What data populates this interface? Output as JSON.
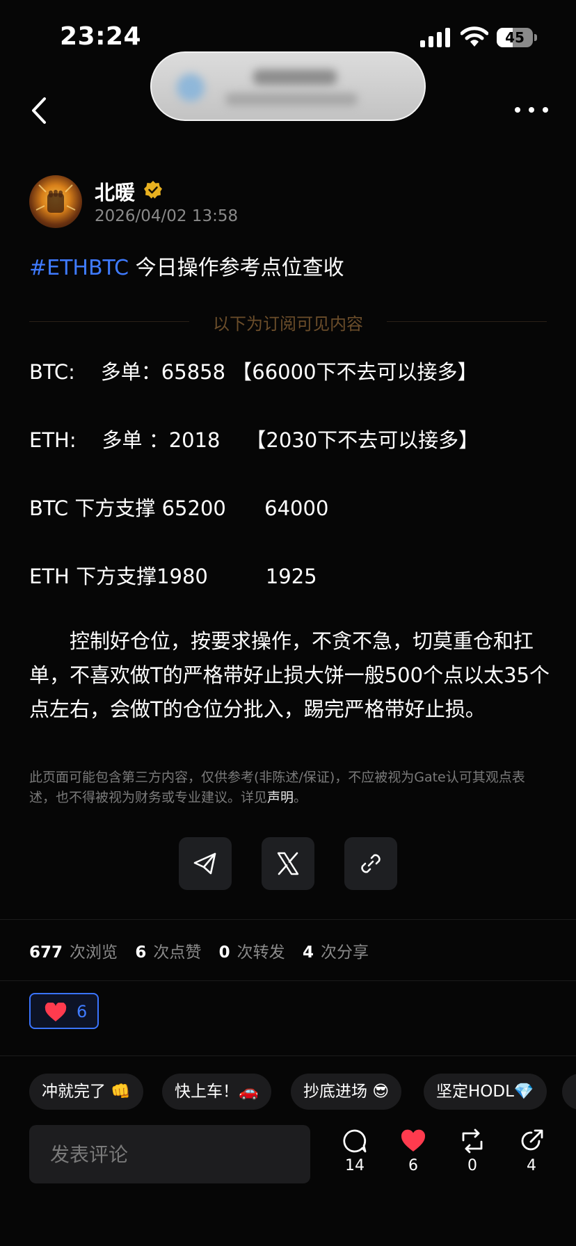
{
  "status_bar": {
    "time": "23:24",
    "battery": "45",
    "battery_level": 0.45
  },
  "post": {
    "author": "北暖",
    "timestamp": "2026/04/02 13:58",
    "hashtag": "#ETHBTC",
    "title": " 今日操作参考点位查收",
    "subscriber_label": "以下为订阅可见内容",
    "lines": [
      "BTC:    多单：65858 【66000下不去可以接多】",
      "ETH:    多单 ：2018    【2030下不去可以接多】",
      "BTC 下方支撑 65200      64000",
      "ETH 下方支撑1980         1925"
    ],
    "paragraph": "　　控制好仓位，按要求操作，不贪不急，切莫重仓和扛单，不喜欢做T的严格带好止损大饼一般500个点以太35个点左右，会做T的仓位分批入，踢完严格带好止损。"
  },
  "disclaimer": {
    "text": "此页面可能包含第三方内容，仅供参考(非陈述/保证)，不应被视为Gate认可其观点表述，也不得被视为财务或专业建议。详见",
    "link": "声明",
    "end": "。"
  },
  "stats": [
    {
      "value": "677",
      "label": "次浏览"
    },
    {
      "value": "6",
      "label": "次点赞"
    },
    {
      "value": "0",
      "label": "次转发"
    },
    {
      "value": "4",
      "label": "次分享"
    }
  ],
  "like_chip": {
    "count": "6"
  },
  "reactions": [
    "冲就完了 👊",
    "快上车！🚗",
    "抄底进场 😎",
    "坚定HODL💎"
  ],
  "comment": {
    "placeholder": "发表评论"
  },
  "actions": {
    "comments": "14",
    "likes": "6",
    "reposts": "0",
    "shares": "4"
  },
  "colors": {
    "accent": "#3f7bff",
    "heart": "#ff3b4e",
    "gold": "#e8b120",
    "subscriber_label": "#6b4d2a"
  },
  "icons": [
    "back-arrow-icon",
    "more-icon",
    "verified-icon",
    "telegram-icon",
    "x-icon",
    "link-icon",
    "heart-icon",
    "comment-icon",
    "repost-icon",
    "share-icon"
  ]
}
